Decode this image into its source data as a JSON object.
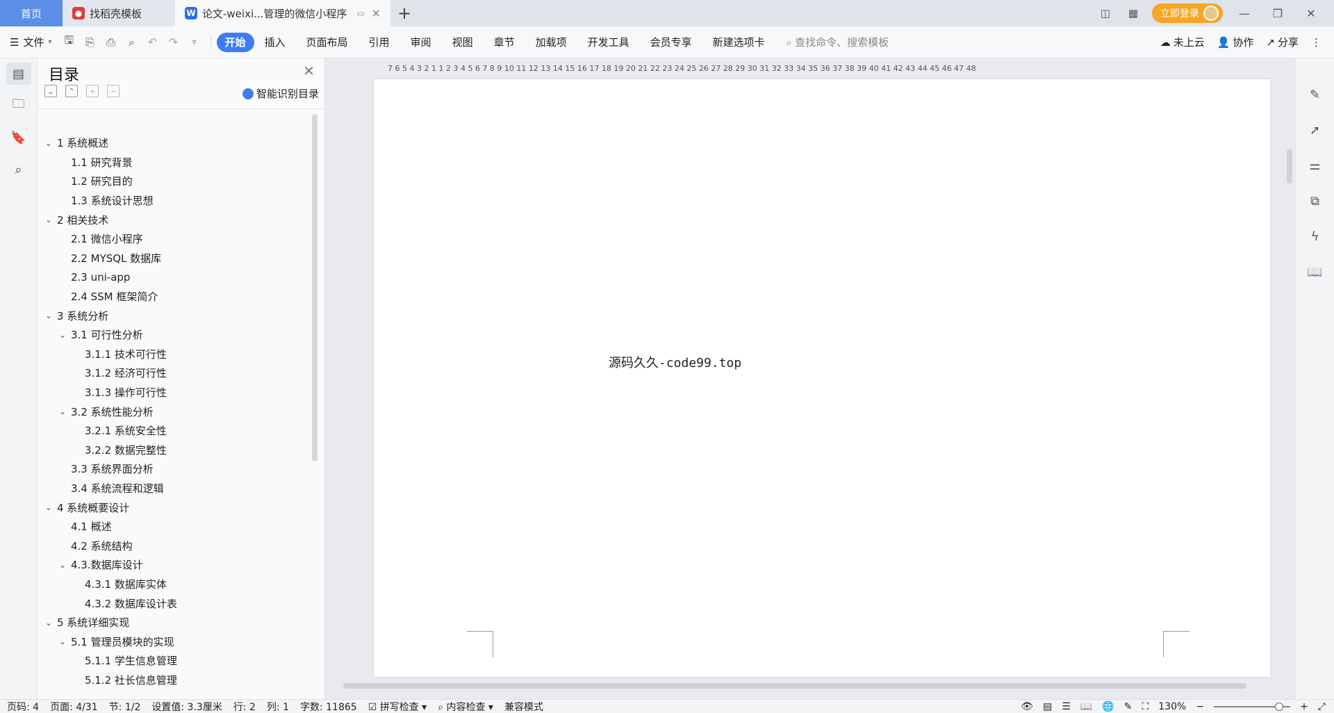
{
  "tabs": {
    "home": "首页",
    "template": "找稻壳模板",
    "document": "论文-weixi...管理的微信小程序"
  },
  "titlebar": {
    "login_label": "立即登录"
  },
  "menu": {
    "file_label": "文件",
    "tabs": [
      "开始",
      "插入",
      "页面布局",
      "引用",
      "审阅",
      "视图",
      "章节",
      "加载项",
      "开发工具",
      "会员专享",
      "新建选项卡"
    ],
    "search_placeholder": "查找命令、搜索模板",
    "cloud_label": "未上云",
    "collab_label": "协作",
    "share_label": "分享"
  },
  "toc": {
    "title": "目录",
    "smart_label": "智能识别目录",
    "items": [
      {
        "label": "1 系统概述",
        "level": 0,
        "expanded": true
      },
      {
        "label": "1.1  研究背景",
        "level": 1
      },
      {
        "label": "1.2 研究目的",
        "level": 1
      },
      {
        "label": "1.3 系统设计思想",
        "level": 1
      },
      {
        "label": "2 相关技术",
        "level": 0,
        "expanded": true
      },
      {
        "label": "2.1 微信小程序",
        "level": 1
      },
      {
        "label": "2.2 MYSQL 数据库",
        "level": 1
      },
      {
        "label": "2.3 uni-app",
        "level": 1
      },
      {
        "label": "2.4 SSM 框架简介",
        "level": 1
      },
      {
        "label": "3 系统分析",
        "level": 0,
        "expanded": true
      },
      {
        "label": "3.1 可行性分析",
        "level": 1,
        "expanded": true
      },
      {
        "label": "3.1.1 技术可行性",
        "level": 2
      },
      {
        "label": "3.1.2 经济可行性",
        "level": 2
      },
      {
        "label": "3.1.3 操作可行性",
        "level": 2
      },
      {
        "label": "3.2 系统性能分析",
        "level": 1,
        "expanded": true
      },
      {
        "label": "3.2.1  系统安全性",
        "level": 2
      },
      {
        "label": "3.2.2  数据完整性",
        "level": 2
      },
      {
        "label": "3.3 系统界面分析",
        "level": 1
      },
      {
        "label": "3.4 系统流程和逻辑",
        "level": 1
      },
      {
        "label": "4 系统概要设计",
        "level": 0,
        "expanded": true
      },
      {
        "label": "4.1 概述",
        "level": 1
      },
      {
        "label": "4.2 系统结构",
        "level": 1
      },
      {
        "label": "4.3.数据库设计",
        "level": 1,
        "expanded": true
      },
      {
        "label": "4.3.1 数据库实体",
        "level": 2
      },
      {
        "label": "4.3.2 数据库设计表",
        "level": 2
      },
      {
        "label": "5 系统详细实现",
        "level": 0,
        "expanded": true
      },
      {
        "label": "5.1  管理员模块的实现",
        "level": 1,
        "expanded": true
      },
      {
        "label": "5.1.1  学生信息管理",
        "level": 2
      },
      {
        "label": "5.1.2  社长信息管理",
        "level": 2
      }
    ]
  },
  "document": {
    "ruler": "7  6  5  4  3  2  1     1  2  3  4  5  6  7  8  9  10  11  12  13  14  15  16  17  18  19  20  21  22  23  24  25  26  27  28  29  30  31  32  33  34  35  36  37  38  39  40  41  42  43  44  45  46  47  48",
    "body_text": "源码久久-code99.top"
  },
  "status": {
    "page_code": "页码: 4",
    "page": "页面: 4/31",
    "section": "节: 1/2",
    "setting": "设置值: 3.3厘米",
    "row": "行: 2",
    "col": "列: 1",
    "word_count": "字数: 11865",
    "spell_check": "拼写检查",
    "content_check": "内容检查",
    "compat_mode": "兼容模式",
    "zoom": "130%"
  }
}
